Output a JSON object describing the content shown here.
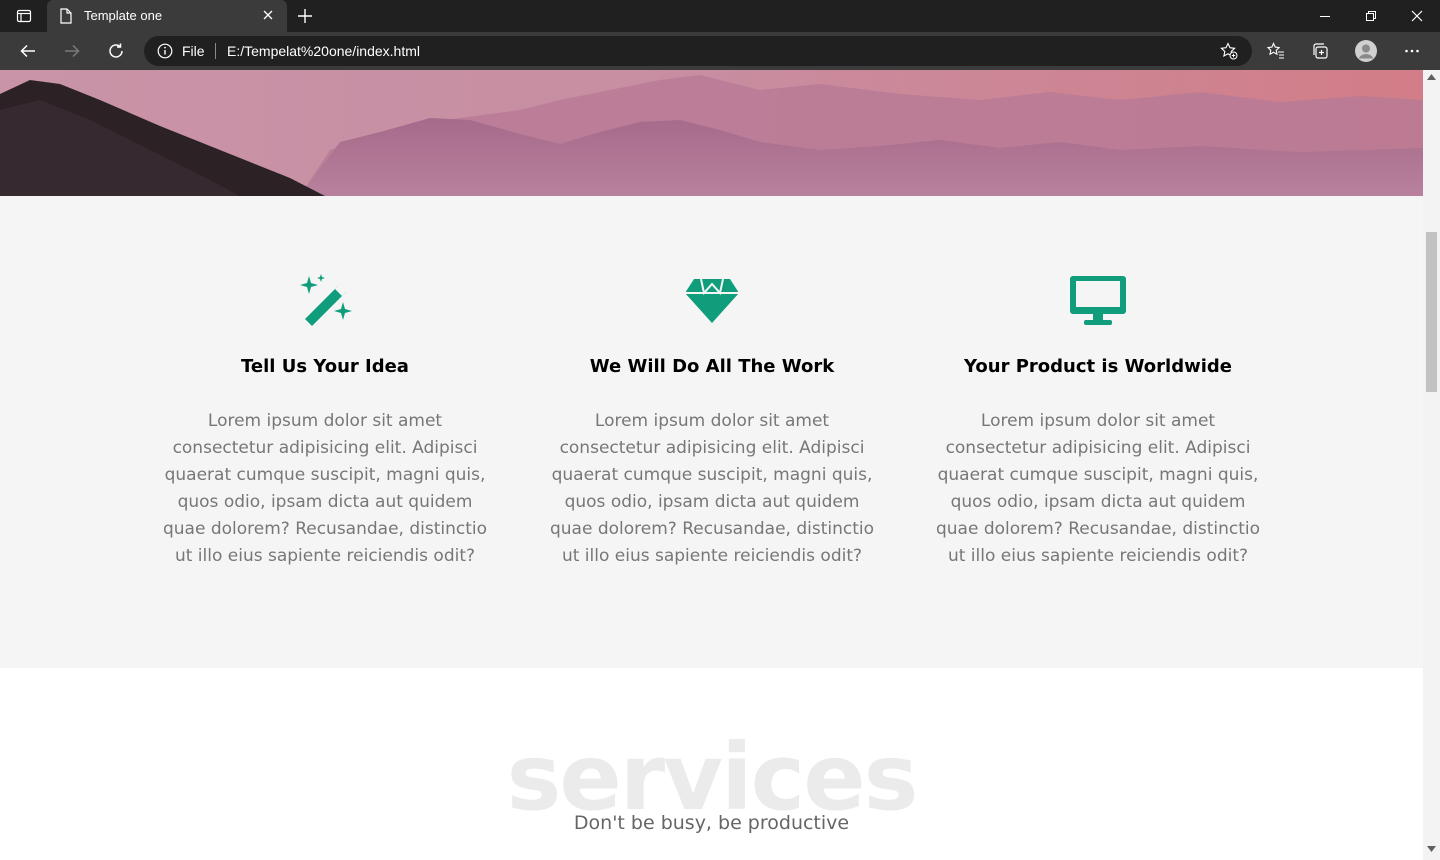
{
  "browser": {
    "tab_title": "Template one",
    "omnibox_scheme_label": "File",
    "url": "E:/Tempelat%20one/index.html"
  },
  "features": [
    {
      "icon": "magic-wand-icon",
      "title": "Tell Us Your Idea",
      "text": "Lorem ipsum dolor sit amet consectetur adipisicing elit. Adipisci quaerat cumque suscipit, magni quis, quos odio, ipsam dicta aut quidem quae dolorem? Recusandae, distinctio ut illo eius sapiente reiciendis odit?"
    },
    {
      "icon": "gem-icon",
      "title": "We Will Do All The Work",
      "text": "Lorem ipsum dolor sit amet consectetur adipisicing elit. Adipisci quaerat cumque suscipit, magni quis, quos odio, ipsam dicta aut quidem quae dolorem? Recusandae, distinctio ut illo eius sapiente reiciendis odit?"
    },
    {
      "icon": "monitor-icon",
      "title": "Your Product is Worldwide",
      "text": "Lorem ipsum dolor sit amet consectetur adipisicing elit. Adipisci quaerat cumque suscipit, magni quis, quos odio, ipsam dicta aut quidem quae dolorem? Recusandae, distinctio ut illo eius sapiente reiciendis odit?"
    }
  ],
  "services": {
    "heading": "services",
    "subtitle": "Don't be busy, be productive"
  },
  "colors": {
    "accent": "#0f9d7c",
    "chrome_dark": "#202020",
    "chrome_mid": "#3b3b3b",
    "section_bg": "#f5f5f5"
  }
}
